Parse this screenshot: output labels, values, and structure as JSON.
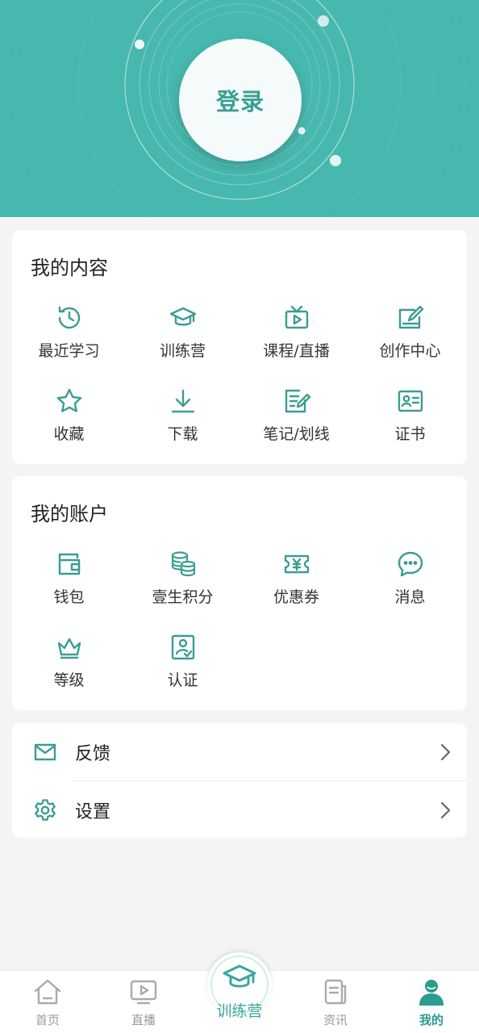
{
  "header": {
    "login_label": "登录"
  },
  "my_content": {
    "title": "我的内容",
    "items": [
      {
        "label": "最近学习",
        "icon": "history-icon"
      },
      {
        "label": "训练营",
        "icon": "graduation-cap-icon"
      },
      {
        "label": "课程/直播",
        "icon": "tv-play-icon"
      },
      {
        "label": "创作中心",
        "icon": "edit-icon"
      },
      {
        "label": "收藏",
        "icon": "star-icon"
      },
      {
        "label": "下载",
        "icon": "download-icon"
      },
      {
        "label": "笔记/划线",
        "icon": "note-icon"
      },
      {
        "label": "证书",
        "icon": "certificate-icon"
      }
    ]
  },
  "my_account": {
    "title": "我的账户",
    "items": [
      {
        "label": "钱包",
        "icon": "wallet-icon"
      },
      {
        "label": "壹生积分",
        "icon": "coins-icon"
      },
      {
        "label": "优惠券",
        "icon": "coupon-icon"
      },
      {
        "label": "消息",
        "icon": "message-icon"
      },
      {
        "label": "等级",
        "icon": "crown-icon"
      },
      {
        "label": "认证",
        "icon": "verified-user-icon"
      }
    ]
  },
  "settings_list": {
    "items": [
      {
        "label": "反馈",
        "icon": "mail-icon"
      },
      {
        "label": "设置",
        "icon": "gear-icon"
      }
    ]
  },
  "tabbar": {
    "tabs": [
      {
        "label": "首页",
        "icon": "home-icon"
      },
      {
        "label": "直播",
        "icon": "play-screen-icon"
      },
      {
        "label": "训练营",
        "icon": "graduation-cap-icon"
      },
      {
        "label": "资讯",
        "icon": "news-icon"
      },
      {
        "label": "我的",
        "icon": "user-icon"
      }
    ],
    "active": "我的"
  },
  "colors": {
    "accent": "#47b8ae",
    "icon": "#3a9d93",
    "inactive": "#9a9a9a",
    "background": "#f4f4f4"
  }
}
